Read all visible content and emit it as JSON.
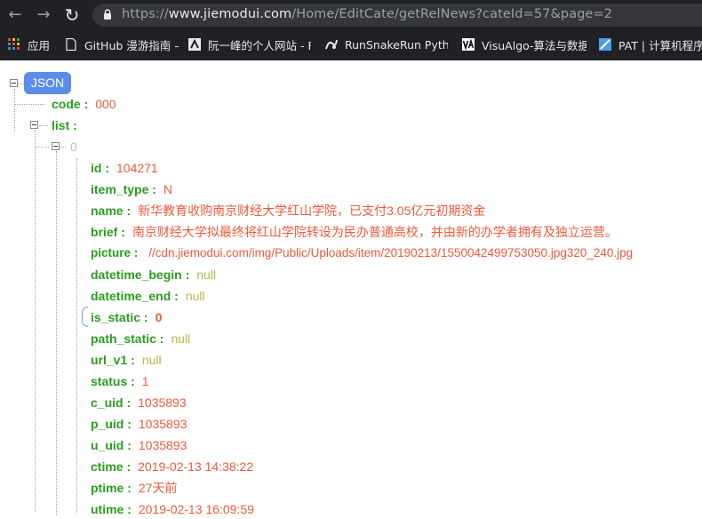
{
  "browser": {
    "url_prefix": "https://",
    "url_host": "www.jiemodui.com",
    "url_path": "/Home/EditCate/getRelNews?cateId=57&page=2",
    "bookmarks": [
      {
        "label": "应用"
      },
      {
        "label": "GitHub 漫游指南 –"
      },
      {
        "label": "阮一峰的个人网站 - F"
      },
      {
        "label": "RunSnakeRun Pytho"
      },
      {
        "label": "VisuAlgo-算法与数据"
      },
      {
        "label": "PAT | 计算机程序设"
      }
    ]
  },
  "viewer": {
    "badge": "JSON",
    "root": [
      {
        "key": "code :",
        "value": "000"
      },
      {
        "key": "list :"
      }
    ],
    "index_label": "0",
    "fields": [
      {
        "key": "id :",
        "value": "104271",
        "kind": "num"
      },
      {
        "key": "item_type :",
        "value": "N",
        "kind": "str"
      },
      {
        "key": "name :",
        "value": "新华教育收购南京财经大学红山学院，已支付3.05亿元初期资金",
        "kind": "str"
      },
      {
        "key": "brief :",
        "value": "南京财经大学拟最终将红山学院转设为民办普通高校，并由新的办学者拥有及独立运营。",
        "kind": "str"
      },
      {
        "key": "picture :",
        "value": "//cdn.jiemodui.com/img/Public/Uploads/item/20190213/1550042499753050.jpg320_240.jpg",
        "kind": "str"
      },
      {
        "key": "datetime_begin :",
        "value": "null",
        "kind": "null"
      },
      {
        "key": "datetime_end :",
        "value": "null",
        "kind": "null"
      },
      {
        "key": "is_static :",
        "value": "0",
        "kind": "bool"
      },
      {
        "key": "path_static :",
        "value": "null",
        "kind": "null"
      },
      {
        "key": "url_v1 :",
        "value": "null",
        "kind": "null"
      },
      {
        "key": "status :",
        "value": "1",
        "kind": "num"
      },
      {
        "key": "c_uid :",
        "value": "1035893",
        "kind": "num"
      },
      {
        "key": "p_uid :",
        "value": "1035893",
        "kind": "num"
      },
      {
        "key": "u_uid :",
        "value": "1035893",
        "kind": "num"
      },
      {
        "key": "ctime :",
        "value": "2019-02-13 14:38:22",
        "kind": "str"
      },
      {
        "key": "ptime :",
        "value": "27天前",
        "kind": "str"
      },
      {
        "key": "utime :",
        "value": "2019-02-13 16:09:59",
        "kind": "str"
      }
    ]
  },
  "colors": {
    "key": "#2a9d1e",
    "value": "#ee5a3a",
    "null": "#b5b54a",
    "badge": "#5b8de8",
    "chrome": "#202124"
  }
}
